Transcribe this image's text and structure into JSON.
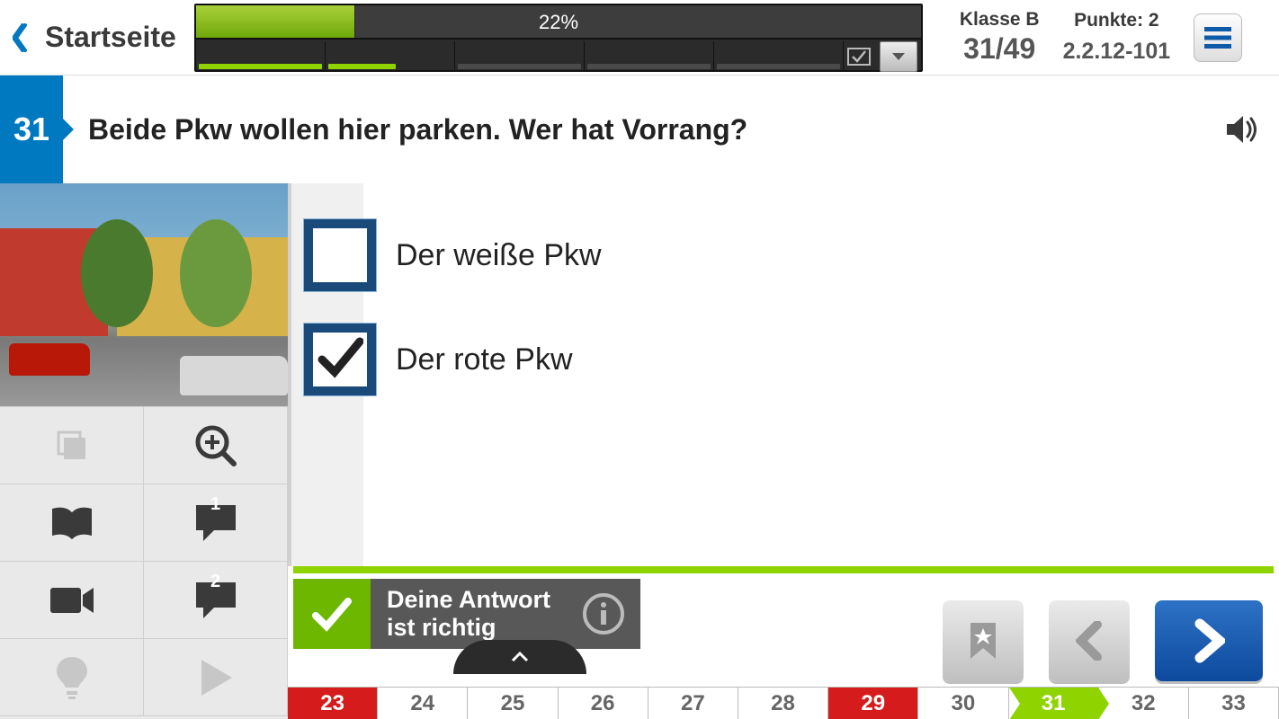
{
  "header": {
    "home_label": "Startseite",
    "progress_pct_label": "22%",
    "progress_pct_value": 22,
    "class_label": "Klasse B",
    "counter": "31/49",
    "points_label": "Punkte: 2",
    "question_id": "2.2.12-101"
  },
  "question": {
    "number": "31",
    "text": "Beide Pkw wollen hier parken. Wer hat Vorrang?"
  },
  "answers": [
    {
      "label": "Der weiße Pkw",
      "user_checked": false,
      "correct_checked": false
    },
    {
      "label": "Der rote Pkw",
      "user_checked": true,
      "correct_checked": true
    }
  ],
  "feedback": {
    "text": "Deine Antwort ist richtig",
    "correct": true
  },
  "tools": {
    "comment_1": "1",
    "comment_2": "2"
  },
  "qnav": [
    {
      "n": "23",
      "st": "red"
    },
    {
      "n": "24",
      "st": ""
    },
    {
      "n": "25",
      "st": ""
    },
    {
      "n": "26",
      "st": ""
    },
    {
      "n": "27",
      "st": ""
    },
    {
      "n": "28",
      "st": ""
    },
    {
      "n": "29",
      "st": "red"
    },
    {
      "n": "30",
      "st": ""
    },
    {
      "n": "31",
      "st": "green"
    },
    {
      "n": "32",
      "st": ""
    },
    {
      "n": "33",
      "st": ""
    }
  ]
}
